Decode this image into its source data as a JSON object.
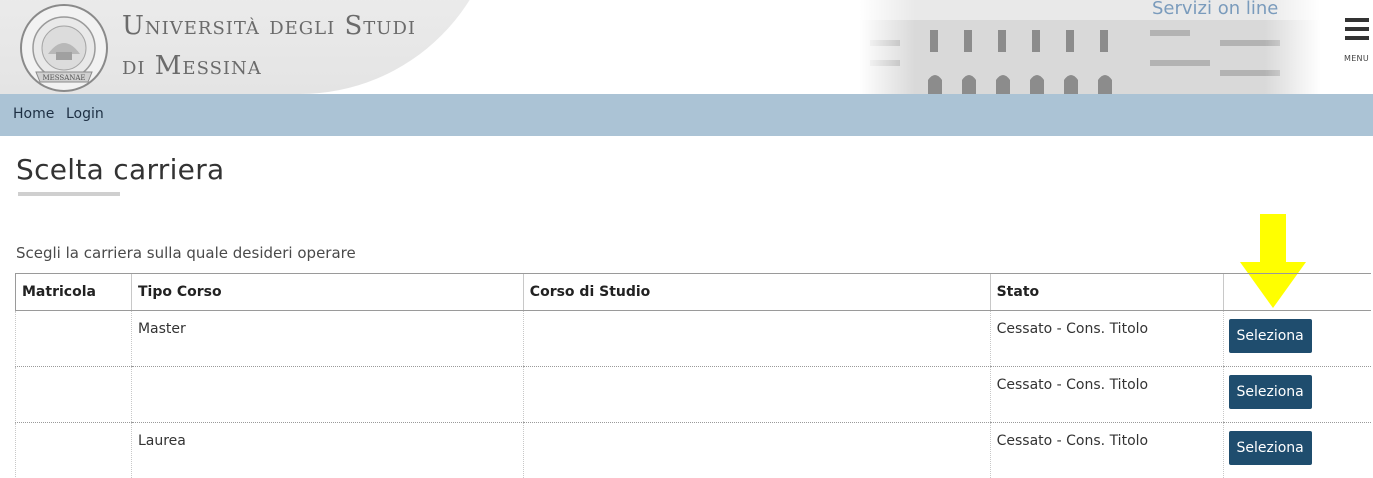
{
  "header": {
    "university_line1": "Università degli Studi",
    "university_line2": "di Messina",
    "servizi_label": "Servizi on line",
    "menu_label": "MENU",
    "logo_text": "STUDIORUM UNIVERSITAS MESSANAE"
  },
  "nav": {
    "home": "Home",
    "login": "Login"
  },
  "page": {
    "title": "Scelta carriera",
    "intro": "Scegli la carriera sulla quale desideri operare"
  },
  "table": {
    "headers": [
      "Matricola",
      "Tipo Corso",
      "Corso di Studio",
      "Stato",
      ""
    ],
    "rows": [
      {
        "matricola": "",
        "tipo_corso": "Master",
        "corso_di_studio": "",
        "stato": "Cessato - Cons. Titolo",
        "action": "Seleziona"
      },
      {
        "matricola": "",
        "tipo_corso": "",
        "corso_di_studio": "",
        "stato": "Cessato - Cons. Titolo",
        "action": "Seleziona"
      },
      {
        "matricola": "",
        "tipo_corso": "Laurea",
        "corso_di_studio": "",
        "stato": "Cessato - Cons. Titolo",
        "action": "Seleziona"
      }
    ]
  },
  "colors": {
    "navbar": "#abc3d5",
    "button": "#1f4d6e",
    "arrow": "#ffff00"
  },
  "icons": [
    "university-seal-icon",
    "hamburger-menu-icon",
    "down-arrow-annotation-icon"
  ]
}
